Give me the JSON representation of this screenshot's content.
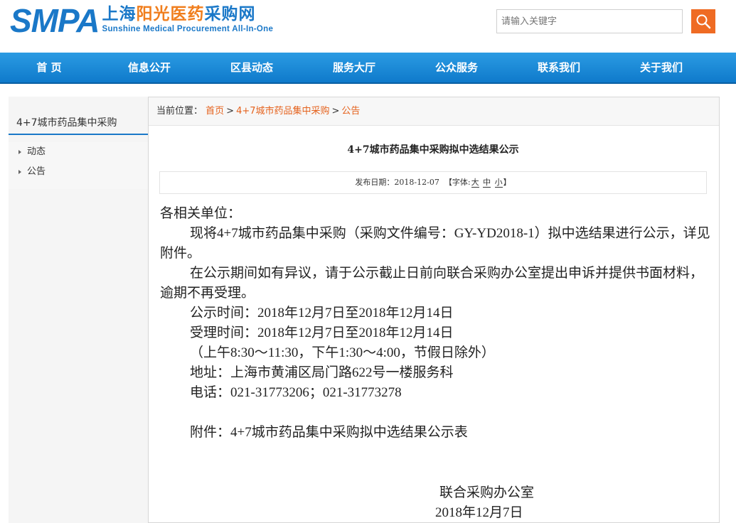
{
  "header": {
    "logo_smpa": "SMPA",
    "logo_cn_part1": "上海",
    "logo_cn_part2": "阳光医药",
    "logo_cn_part3": "采购网",
    "logo_en": "Sunshine Medical Procurement All-In-One",
    "search_placeholder": "请输入关键字",
    "search_icon": "search-icon"
  },
  "nav": {
    "items": [
      "首 页",
      "信息公开",
      "区县动态",
      "服务大厅",
      "公众服务",
      "联系我们",
      "关于我们"
    ]
  },
  "sidebar": {
    "title": "4+7城市药品集中采购",
    "items": [
      "动态",
      "公告"
    ]
  },
  "breadcrumb": {
    "label": "当前位置：",
    "links": [
      "首页",
      "4+7城市药品集中采购",
      "公告"
    ],
    "separator": ">"
  },
  "article": {
    "title": "4+7城市药品集中采购拟中选结果公示",
    "date_label": "发布日期：2018-12-07",
    "font_label_open": "【字体:",
    "font_large": "大",
    "font_medium": "中",
    "font_small": "小",
    "font_label_close": "】",
    "salutation": "各相关单位：",
    "para1": "现将4+7城市药品集中采购（采购文件编号：GY-YD2018-1）拟中选结果进行公示，详见附件。",
    "para2": "在公示期间如有异议，请于公示截止日前向联合采购办公室提出申诉并提供书面材料，逾期不再受理。",
    "line_notice_time": "公示时间：2018年12月7日至2018年12月14日",
    "line_accept_time": "受理时间：2018年12月7日至2018年12月14日",
    "line_hours": "（上午8:30～11:30，下午1:30～4:00，节假日除外）",
    "line_address": "地址：上海市黄浦区局门路622号一楼服务科",
    "line_phone": "电话：021-31773206；021-31773278",
    "line_attachment": "附件：4+7城市药品集中采购拟中选结果公示表",
    "sign_org": "联合采购办公室",
    "sign_date": "2018年12月7日"
  },
  "colors": {
    "brand_blue": "#1a78c8",
    "brand_orange": "#f07e1d",
    "search_button": "#ef6b23",
    "link_orange": "#e5621d"
  }
}
